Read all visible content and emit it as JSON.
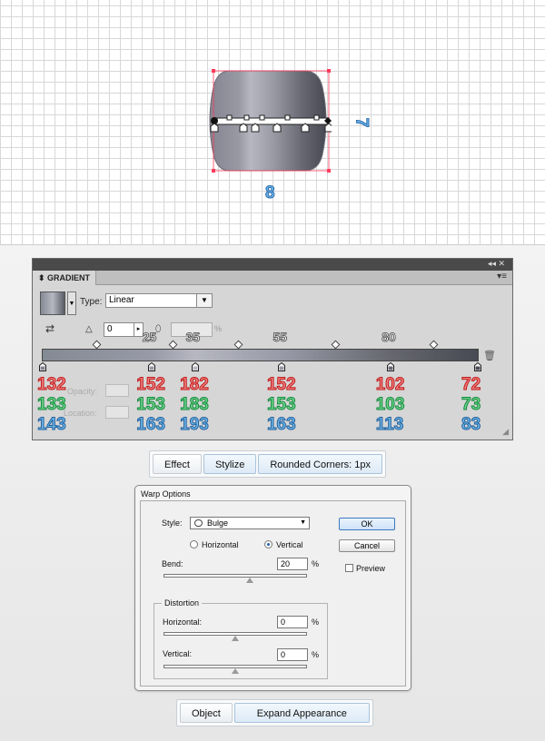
{
  "annotations": {
    "shape_side_label": "7",
    "shape_bottom_label": "8"
  },
  "gradient_panel": {
    "panel_title": "GRADIENT",
    "type_label": "Type:",
    "type_value": "Linear",
    "angle_value": "0",
    "aspect_unit": "%",
    "opacity_label": "Opacity:",
    "location_label": "Location:",
    "midpoints": [
      {
        "label": "25",
        "position": 25
      },
      {
        "label": "35",
        "position": 35
      },
      {
        "label": "55",
        "position": 55
      },
      {
        "label": "80",
        "position": 80
      }
    ],
    "stops": [
      {
        "position": 0,
        "r": "132",
        "g": "133",
        "b": "143",
        "color": "#848591"
      },
      {
        "position": 25,
        "r": "152",
        "g": "153",
        "b": "163",
        "color": "#9899a3"
      },
      {
        "position": 35,
        "r": "182",
        "g": "183",
        "b": "193",
        "color": "#b6b7c1"
      },
      {
        "position": 55,
        "r": "152",
        "g": "153",
        "b": "163",
        "color": "#9899a3"
      },
      {
        "position": 80,
        "r": "102",
        "g": "103",
        "b": "113",
        "color": "#666771"
      },
      {
        "position": 100,
        "r": "72",
        "g": "73",
        "b": "83",
        "color": "#484953"
      }
    ]
  },
  "menu_path_1": {
    "items": [
      "Effect",
      "Stylize",
      "Rounded Corners: 1px"
    ]
  },
  "warp_dialog": {
    "title": "Warp Options",
    "style_label": "Style:",
    "style_value": "Bulge",
    "horizontal_radio": "Horizontal",
    "vertical_radio": "Vertical",
    "orientation_selected": "Vertical",
    "bend_label": "Bend:",
    "bend_value": "20",
    "bend_unit": "%",
    "distortion_label": "Distortion",
    "horizontal_label": "Horizontal:",
    "horizontal_value": "0",
    "horizontal_unit": "%",
    "vertical_label": "Vertical:",
    "vertical_value": "0",
    "vertical_unit": "%",
    "ok_label": "OK",
    "cancel_label": "Cancel",
    "preview_label": "Preview",
    "preview_checked": false
  },
  "menu_path_2": {
    "items": [
      "Object",
      "Expand Appearance"
    ]
  },
  "colors": {
    "red_outline": "#c01a1a",
    "green_outline": "#138a3c",
    "blue_outline": "#1f5f9e",
    "selection": "#ff3b5c"
  }
}
